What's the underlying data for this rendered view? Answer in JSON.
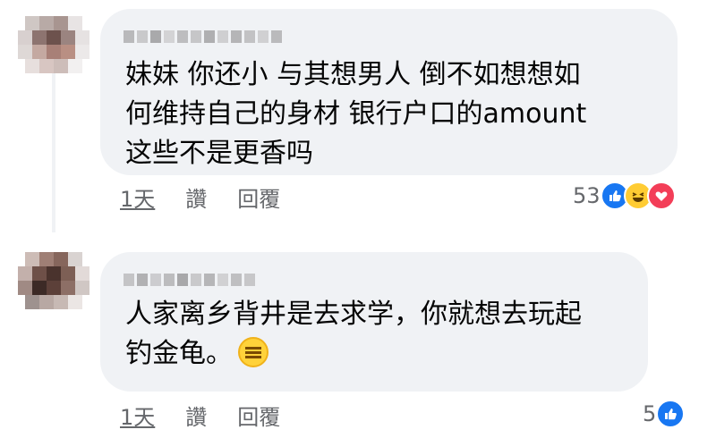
{
  "comments": [
    {
      "text": "妹妹 你还小 与其想男人 倒不如想想如\n何维持自己的身材 银行户口的amount\n这些不是更香吗",
      "time": "1天",
      "like_label": "讚",
      "reply_label": "回覆",
      "reaction_count": "53",
      "reactions": [
        "like-icon",
        "haha-icon",
        "love-icon"
      ]
    },
    {
      "text": "人家离乡背井是去求学，你就想去玩起\n钓金龟。",
      "emoji": "expressionless-face-icon",
      "time": "1天",
      "like_label": "讚",
      "reply_label": "回覆",
      "reaction_count": "5",
      "reactions": [
        "like-icon"
      ]
    }
  ],
  "colors": {
    "bubble": "#f0f2f5",
    "meta_text": "#65676b",
    "like": "#1877f2",
    "haha": "#ffcc33",
    "love": "#f33e58"
  }
}
